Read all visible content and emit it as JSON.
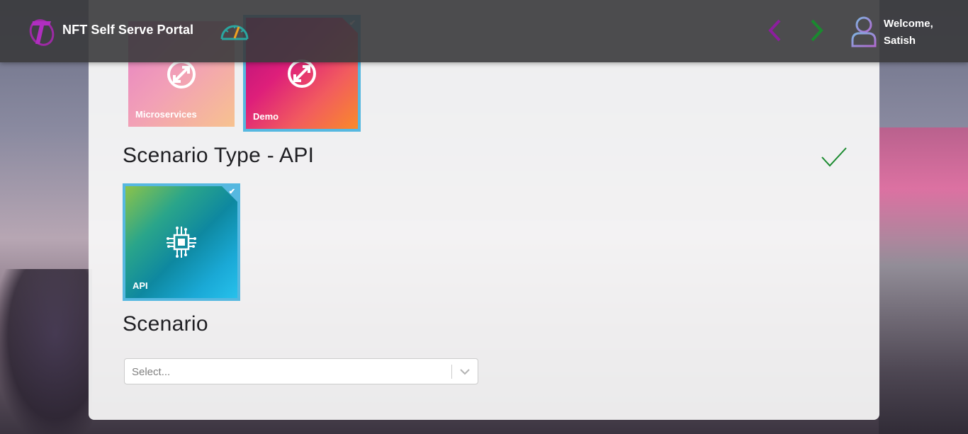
{
  "header": {
    "app_title": "NFT Self Serve Portal",
    "welcome_line1": "Welcome,",
    "welcome_line2": "Satish"
  },
  "icons": {
    "logo": "telstra-logo-icon",
    "dashboard": "speedometer-icon",
    "back": "chevron-left-icon",
    "forward": "chevron-right-icon",
    "user": "user-avatar-icon"
  },
  "app_type": {
    "tiles": [
      {
        "label": "Microservices",
        "selected": false,
        "icon": "refresh-arrows-icon"
      },
      {
        "label": "Demo",
        "selected": true,
        "icon": "refresh-arrows-icon"
      }
    ]
  },
  "scenario_type": {
    "title": "Scenario Type - API",
    "complete": true,
    "tiles": [
      {
        "label": "API",
        "selected": true,
        "icon": "circuit-chip-icon"
      }
    ]
  },
  "scenario": {
    "title": "Scenario",
    "select_placeholder": "Select..."
  },
  "colors": {
    "accent_purple": "#8c1e9e",
    "accent_green": "#1a8a2f",
    "selected_border": "#56b8e0"
  }
}
